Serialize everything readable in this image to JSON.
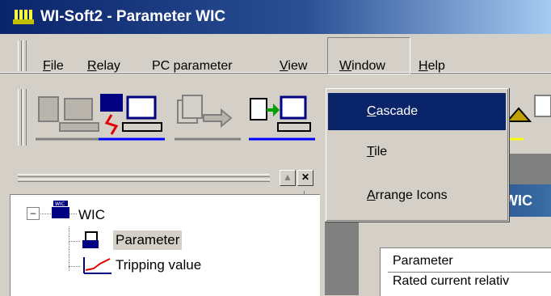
{
  "window": {
    "title": "WI-Soft2 - Parameter  WIC",
    "app_icon": "wi-logo"
  },
  "menubar": {
    "items": [
      {
        "label": "File",
        "accel": "F",
        "rest": "ile"
      },
      {
        "label": "Relay",
        "accel": "R",
        "rest": "elay"
      },
      {
        "label": "PC parameter"
      },
      {
        "label": "View",
        "accel": "V",
        "rest": "iew"
      },
      {
        "label": "Window",
        "accel": "W",
        "rest": "indow"
      },
      {
        "label": "Help",
        "accel": "H",
        "rest": "elp"
      }
    ],
    "open_menu": "Window"
  },
  "dropdown": {
    "items": [
      {
        "label": "Cascade",
        "accel": "C",
        "rest": "ascade",
        "selected": true
      },
      {
        "label": "Tile",
        "accel": "T",
        "rest": "ile",
        "selected": false
      },
      {
        "label": "Arrange Icons",
        "accel": "A",
        "rest": "rrange Icons",
        "selected": false
      }
    ]
  },
  "toolbar": {
    "buttons": [
      "relay-pc-icon",
      "relay-connect-icon",
      "transfer-icon",
      "send-to-pc-icon",
      "partial-icon"
    ]
  },
  "tree": {
    "expander": "⊟",
    "root": {
      "label": "WIC",
      "icon": "wic-device-icon"
    },
    "children": [
      {
        "label": "Parameter",
        "icon": "parameter-icon",
        "selected": true
      },
      {
        "label": "Tripping value",
        "icon": "tripping-curve-icon",
        "selected": false
      }
    ]
  },
  "child_window": {
    "title_fragment": "WIC",
    "table": {
      "header": "Parameter",
      "rows": [
        "Rated current relativ"
      ]
    }
  },
  "colors": {
    "face": "#d4d0c8",
    "title_blue": "#0a246a",
    "selection": "#0a246a"
  }
}
